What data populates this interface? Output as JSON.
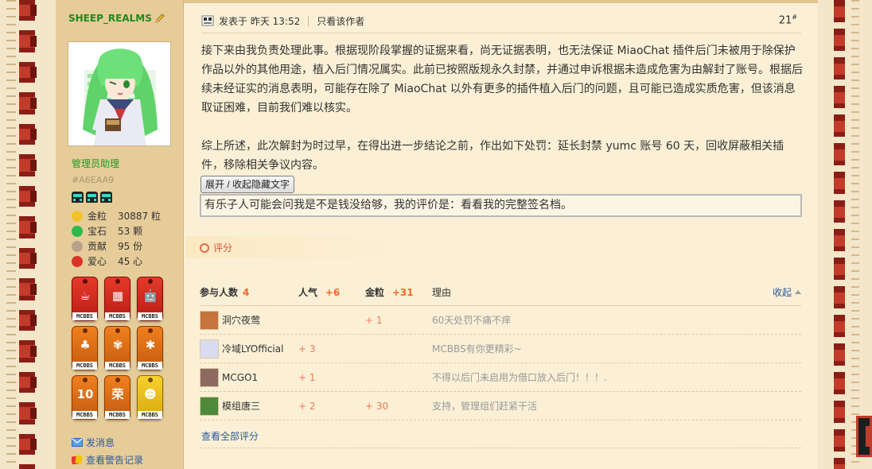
{
  "user": {
    "name": "SHEEP_REALMS",
    "group": "管理员助理",
    "color_code": "#A6EAA9",
    "stats": [
      {
        "label": "金粒",
        "value": "30887 粒",
        "icon": "gold-nugget-icon",
        "color": "#f2c22d"
      },
      {
        "label": "宝石",
        "value": "53 颗",
        "icon": "emerald-icon",
        "color": "#2fb84a"
      },
      {
        "label": "贡献",
        "value": "95 份",
        "icon": "contribution-icon",
        "color": "#b9a08a"
      },
      {
        "label": "爱心",
        "value": "45 心",
        "icon": "heart-apple-icon",
        "color": "#d9342a"
      }
    ],
    "medal_label": "MCBBS",
    "medals": [
      {
        "name": "medal-java",
        "glyph": "☕",
        "style": "red"
      },
      {
        "name": "medal-windows",
        "glyph": "▦",
        "style": "red"
      },
      {
        "name": "medal-android",
        "glyph": "🤖",
        "style": "red"
      },
      {
        "name": "medal-grass",
        "glyph": "♣",
        "style": "orange"
      },
      {
        "name": "medal-vine",
        "glyph": "✾",
        "style": "orange"
      },
      {
        "name": "medal-nether",
        "glyph": "✱",
        "style": "orange"
      },
      {
        "name": "medal-10-years",
        "glyph": "10",
        "style": "orange"
      },
      {
        "name": "medal-honor",
        "glyph": "荣",
        "style": "orange"
      },
      {
        "name": "medal-villager",
        "glyph": "☻",
        "style": "yellow"
      }
    ],
    "links": {
      "message": "发消息",
      "warnings": "查看警告记录"
    }
  },
  "post": {
    "posted_at": "发表于 昨天 13:52",
    "only_author": "只看该作者",
    "floor_number": "21",
    "floor_suffix": "#",
    "paragraph1": "接下来由我负责处理此事。根据现阶段掌握的证据来看，尚无证据表明，也无法保证 MiaoChat 插件后门未被用于除保护作品以外的其他用途，植入后门情况属实。此前已按照版规永久封禁，并通过申诉根据未造成危害为由解封了账号。根据后续未经证实的消息表明，可能存在除了 MiaoChat 以外有更多的插件植入后门的问题，且可能已造成实质危害，但该消息取证困难，目前我们难以核实。",
    "paragraph2": "综上所述，此次解封为时过早，在得出进一步结论之前，作出如下处罚：延长封禁 yumc 账号 60 天，回收屏蔽相关插件，移除相关争议内容。",
    "spoiler_button": "展开 / 收起隐藏文字",
    "spoiler_text": "有乐子人可能会问我是不是钱没给够，我的评价是：看看我的完整签名档。"
  },
  "rating": {
    "title": "评分",
    "headers": {
      "participants": "参与人数",
      "participants_count": "4",
      "popularity": "人气",
      "popularity_total": "+6",
      "gold": "金粒",
      "gold_total": "+31",
      "reason": "理由"
    },
    "collapse": "收起",
    "rows": [
      {
        "name": "洞穴夜莺",
        "popularity": "",
        "gold": "+ 1",
        "reason": "60天处罚不痛不痒",
        "avatar_color": "#c6733e"
      },
      {
        "name": "冷域LYOfficial",
        "popularity": "+ 3",
        "gold": "",
        "reason": "MCBBS有你更精彩~",
        "avatar_color": "#d9dcef"
      },
      {
        "name": "MCGO1",
        "popularity": "+ 1",
        "gold": "",
        "reason": "不得以后门未启用为借口放入后门！！！.",
        "avatar_color": "#8c6a60"
      },
      {
        "name": "模组唐三",
        "popularity": "+ 2",
        "gold": "+ 30",
        "reason": "支持，管理组们赶紧干活",
        "avatar_color": "#4f8a3a"
      }
    ],
    "view_all": "查看全部评分"
  }
}
